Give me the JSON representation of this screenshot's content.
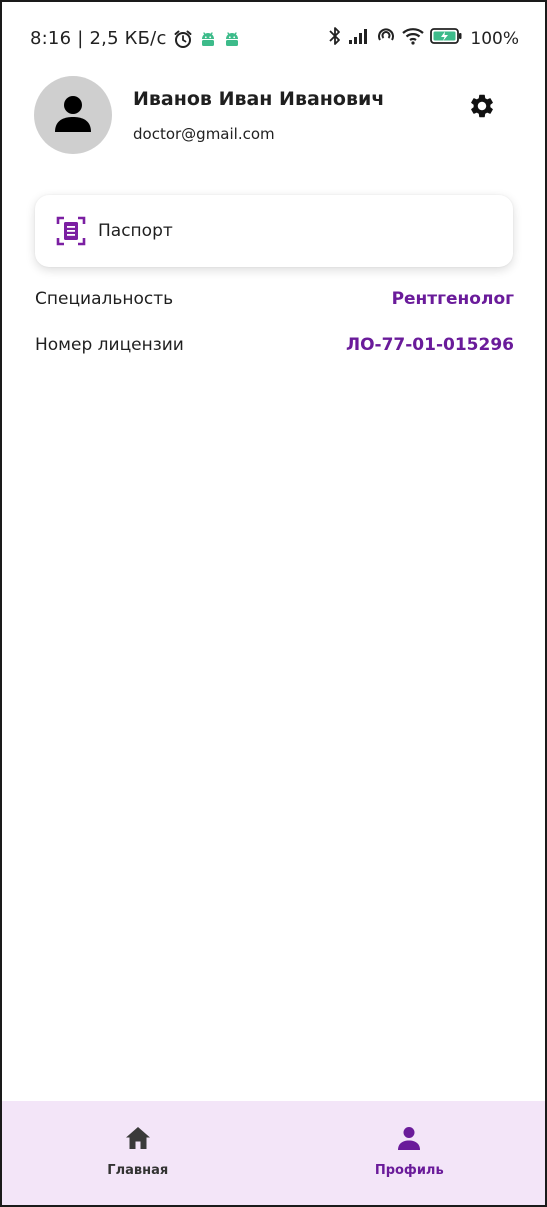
{
  "status_bar": {
    "time": "8:16",
    "network_speed": "2,5 КБ/с",
    "battery": "100%"
  },
  "icons": {
    "alarm": "alarm-icon",
    "app1": "android-icon",
    "app2": "android-icon",
    "bluetooth": "bluetooth-icon",
    "signal": "signal-icon",
    "wifi": "wifi-icon",
    "battery": "battery-icon",
    "avatar": "person-icon",
    "settings": "gear-icon",
    "passport": "document-scan-icon",
    "home": "home-icon",
    "profile": "person-icon"
  },
  "colors": {
    "accent": "#6a1b9a",
    "nav_bg": "#f3e5f8",
    "avatar_bg": "#cfcfcf",
    "passport_icon": "#7b1fa2",
    "status_green": "#3dbb8a"
  },
  "profile": {
    "name": "Иванов Иван Иванович",
    "email": "doctor@gmail.com"
  },
  "passport_card": {
    "label": "Паспорт"
  },
  "info": [
    {
      "label": "Специальность",
      "value": "Рентгенолог"
    },
    {
      "label": "Номер лицензии",
      "value": "ЛО-77-01-015296"
    }
  ],
  "bottom_nav": {
    "items": [
      {
        "label": "Главная",
        "active": false
      },
      {
        "label": "Профиль",
        "active": true
      }
    ]
  }
}
